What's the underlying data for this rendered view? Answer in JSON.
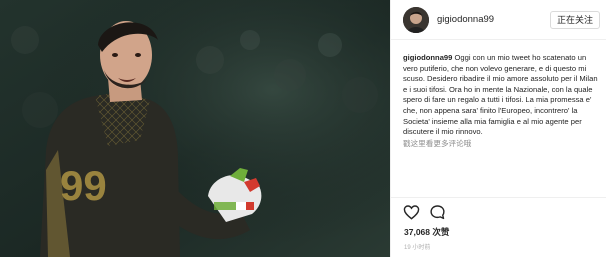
{
  "post": {
    "username": "gigiodonna99",
    "follow_label": "正在关注",
    "caption_user": "gigiodonna99",
    "caption_text": "Oggi con un mio tweet ho scatenato un vero putiferio, che non volevo generare, e di questo mi scuso. Desidero ribadire il mio amore assoluto per il Milan e i suoi tifosi. Ora ho in mente la Nazionale, con la quale spero di fare un regalo a tutti i tifosi. La mia promessa e' che, non appena sara' finito l'Europeo, incontrero' la Societa' insieme alla mia famiglia e al mio agente per discutere il mio rinnovo.",
    "comment_link": "戳这里看更多评论哦",
    "likes_count": "37,068",
    "likes_suffix": " 次赞",
    "timestamp": "19 小时前"
  },
  "icons": {
    "like": "heart-icon",
    "comment": "comment-bubble-icon"
  },
  "colors": {
    "jersey_dark": "#2a2a24",
    "jersey_accent": "#c9a94a",
    "glove_green": "#6fae3a",
    "glove_red": "#d23a2e",
    "background_photo": "#1c2a25"
  }
}
